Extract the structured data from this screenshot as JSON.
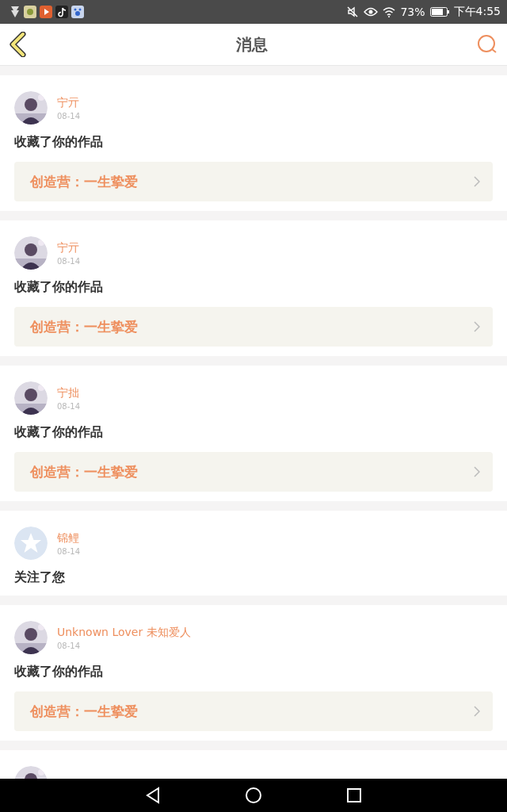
{
  "status_bar": {
    "battery": "73%",
    "time": "下午4:55"
  },
  "header": {
    "title": "消息"
  },
  "messages": [
    {
      "kind": "favorite",
      "name": "宁亓",
      "date": "08-14",
      "action": "收藏了你的作品",
      "link": "创造营：一生挚爱"
    },
    {
      "kind": "favorite",
      "name": "宁亓",
      "date": "08-14",
      "action": "收藏了你的作品",
      "link": "创造营：一生挚爱"
    },
    {
      "kind": "favorite",
      "name": "宁拙",
      "date": "08-14",
      "action": "收藏了你的作品",
      "link": "创造营：一生挚爱"
    },
    {
      "kind": "follow",
      "avatar": {
        "kind": "default"
      },
      "name": "锦鲤",
      "date": "08-14",
      "action": "关注了您"
    },
    {
      "kind": "favorite",
      "name": "Unknown Lover 未知爱人",
      "date": "08-14",
      "action": "收藏了你的作品",
      "link": "创造营：一生挚爱"
    },
    {
      "kind": "cut"
    }
  ]
}
